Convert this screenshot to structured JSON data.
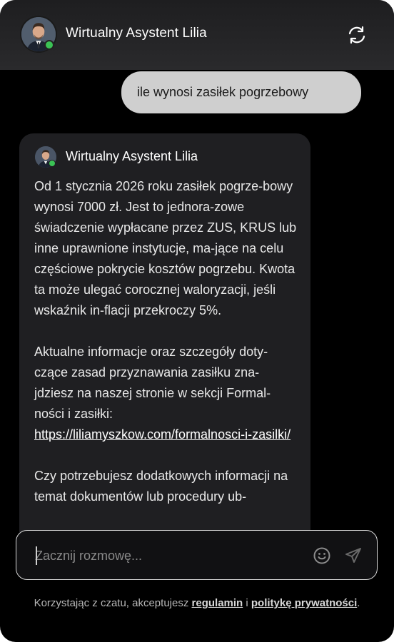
{
  "header": {
    "title": "Wirtualny Asystent Lilia",
    "avatar_icon": "assistant-avatar",
    "refresh_icon": "refresh-icon",
    "status": "online"
  },
  "conversation": {
    "user_message": "ile wynosi zasiłek pogrzebowy",
    "bot": {
      "name": "Wirtualny Asystent Lilia",
      "paragraph1": "Od 1 stycznia 2026 roku zasiłek pogrze-bowy wynosi 7000 zł. Jest to jednora-zowe świadczenie wypłacane przez ZUS, KRUS lub inne uprawnione instytucje, ma-jące na celu częściowe pokrycie kosztów pogrzebu. Kwota ta może ulegać corocznej waloryzacji, jeśli wskaźnik in-flacji przekroczy 5%.",
      "paragraph2": "Aktualne informacje oraz szczegóły doty-czące zasad przyznawania zasiłku zna-jdziesz na naszej stronie w sekcji Formal-ności i zasiłki:",
      "link": "https://liliamyszkow.com/formalnosci-i-zasilki/",
      "paragraph3": "Czy potrzebujesz dodatkowych informacji na temat dokumentów lub procedury ub-"
    }
  },
  "composer": {
    "placeholder": "Zacznij rozmowę...",
    "emoji_icon": "emoji-icon",
    "send_icon": "send-icon"
  },
  "footer": {
    "prefix": "Korzystając z czatu, akceptujesz ",
    "terms_link": "regulamin",
    "middle": " i ",
    "privacy_link": "politykę prywatności",
    "suffix": "."
  },
  "colors": {
    "background": "#000000",
    "header": "#262628",
    "user_bubble": "#cfcfcf",
    "bot_card": "#1f1f22",
    "online": "#3bc255"
  }
}
